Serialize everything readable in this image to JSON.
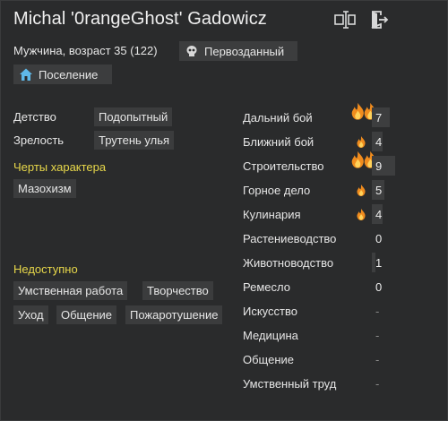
{
  "pawn": {
    "name": "Michal '0rangeGhost' Gadowicz",
    "subtitle": "Мужчина, возраст 35 (122)",
    "faction_label": "Первозданный",
    "settlement_label": "Поселение"
  },
  "header_icons": [
    "rename-icon",
    "banish-icon"
  ],
  "backstory": {
    "childhood_label": "Детство",
    "childhood_value": "Подопытный",
    "adulthood_label": "Зрелость",
    "adulthood_value": "Трутень улья"
  },
  "traits": {
    "title": "Черты характера",
    "items": [
      "Мазохизм"
    ]
  },
  "incapable": {
    "title": "Недоступно",
    "items": [
      "Умственная работа",
      "Творчество",
      "Уход",
      "Общение",
      "Пожаротушение"
    ]
  },
  "skills": [
    {
      "name": "Дальний бой",
      "level": "7",
      "passion": 2,
      "fill": 0.24
    },
    {
      "name": "Ближний бой",
      "level": "4",
      "passion": 1,
      "fill": 0.14
    },
    {
      "name": "Строительство",
      "level": "9",
      "passion": 2,
      "fill": 0.31
    },
    {
      "name": "Горное дело",
      "level": "5",
      "passion": 1,
      "fill": 0.17
    },
    {
      "name": "Кулинария",
      "level": "4",
      "passion": 1,
      "fill": 0.14
    },
    {
      "name": "Растениеводство",
      "level": "0",
      "passion": 0,
      "fill": 0.0
    },
    {
      "name": "Животноводство",
      "level": "1",
      "passion": 0,
      "fill": 0.03
    },
    {
      "name": "Ремесло",
      "level": "0",
      "passion": 0,
      "fill": 0.0
    },
    {
      "name": "Искусство",
      "level": "-",
      "passion": 0,
      "fill": 0.0
    },
    {
      "name": "Медицина",
      "level": "-",
      "passion": 0,
      "fill": 0.0
    },
    {
      "name": "Общение",
      "level": "-",
      "passion": 0,
      "fill": 0.0
    },
    {
      "name": "Умственный труд",
      "level": "-",
      "passion": 0,
      "fill": 0.0
    }
  ],
  "colors": {
    "heading": "#e8d84a",
    "flame_outer": "#f08c1e",
    "flame_inner": "#ffd25a"
  }
}
